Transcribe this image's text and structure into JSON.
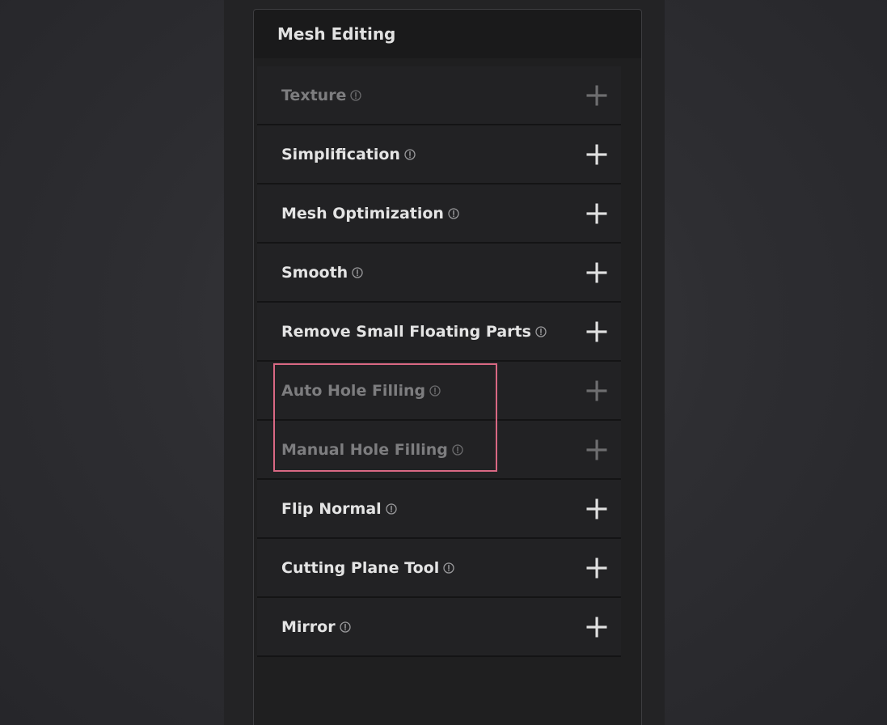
{
  "panel": {
    "title": "Mesh Editing"
  },
  "items": [
    {
      "label": "Texture",
      "enabled": false,
      "icon": "info-icon",
      "action_icon": "plus-icon"
    },
    {
      "label": "Simplification",
      "enabled": true,
      "icon": "info-icon",
      "action_icon": "plus-icon"
    },
    {
      "label": "Mesh Optimization",
      "enabled": true,
      "icon": "info-icon",
      "action_icon": "plus-icon"
    },
    {
      "label": "Smooth",
      "enabled": true,
      "icon": "info-icon",
      "action_icon": "plus-icon"
    },
    {
      "label": "Remove Small Floating Parts",
      "enabled": true,
      "icon": "info-icon",
      "action_icon": "plus-icon"
    },
    {
      "label": "Auto Hole Filling",
      "enabled": false,
      "icon": "info-icon",
      "action_icon": "plus-icon"
    },
    {
      "label": "Manual Hole Filling",
      "enabled": false,
      "icon": "info-icon",
      "action_icon": "plus-icon"
    },
    {
      "label": "Flip Normal",
      "enabled": true,
      "icon": "info-icon",
      "action_icon": "plus-icon"
    },
    {
      "label": "Cutting Plane Tool",
      "enabled": true,
      "icon": "info-icon",
      "action_icon": "plus-icon"
    },
    {
      "label": "Mirror",
      "enabled": true,
      "icon": "info-icon",
      "action_icon": "plus-icon"
    }
  ],
  "colors": {
    "highlight": "#d96883",
    "text_enabled": "#e4e4e4",
    "text_disabled": "#7d7d7f"
  }
}
